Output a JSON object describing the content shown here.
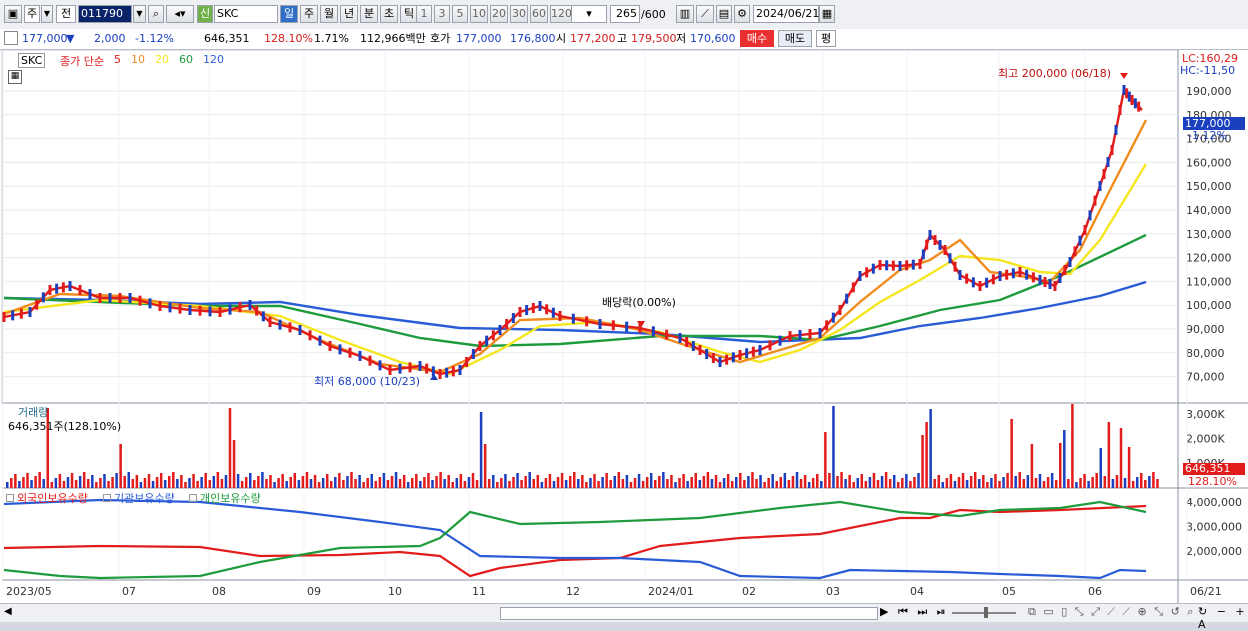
{
  "toolbar": {
    "market_label": "주",
    "view_label": "전",
    "code": "011790",
    "sin_label": "신",
    "name": "SKC",
    "period_tabs": [
      "일",
      "주",
      "월",
      "년",
      "분",
      "초",
      "틱"
    ],
    "active_period": "일",
    "interval_buttons": [
      "1",
      "3",
      "5",
      "10",
      "20",
      "30",
      "60",
      "120"
    ],
    "count": "265",
    "count_total": "/600",
    "date": "2024/06/21"
  },
  "quote": {
    "price": "177,000",
    "change": "2,000",
    "change_rate": "-1.12%",
    "volume": "646,351",
    "volume_ratio": "128.10%",
    "turnover_pct": "1.71%",
    "amount": "112,966백만",
    "ask_label": "호가",
    "ask": "177,000",
    "bid": "176,800",
    "open_label": "시",
    "open": "177,200",
    "high_label": "고",
    "high": "179,500",
    "low_label": "저",
    "low": "170,600",
    "buy_label": "매수",
    "sell_label": "매도",
    "eval_label": "평"
  },
  "price_panel": {
    "stock_label": "SKC",
    "ma_title": "종가 단순",
    "ma_periods": [
      {
        "label": "5",
        "color": "#e21b1b"
      },
      {
        "label": "10",
        "color": "#f08c1e"
      },
      {
        "label": "20",
        "color": "#f5e61e"
      },
      {
        "label": "60",
        "color": "#1e9b3c"
      },
      {
        "label": "120",
        "color": "#2a5bd7"
      }
    ],
    "y_ticks": [
      "190,000",
      "180,000",
      "170,000",
      "160,000",
      "150,000",
      "140,000",
      "130,000",
      "120,000",
      "110,000",
      "100,000",
      "90,000",
      "80,000",
      "70,000"
    ],
    "lc": "LC:160,29",
    "hc": "HC:-11,50",
    "current_price": "177,000",
    "current_change": "-1.12%",
    "high_annotation": "최고 200,000 (06/18)",
    "low_annotation": "최저 68,000 (10/23)",
    "dividend_annotation": "배당락(0.00%)"
  },
  "volume_panel": {
    "title": "거래량",
    "subtitle": "646,351주(128.10%)",
    "y_ticks": [
      "3,000K",
      "2,000K",
      "1,000K"
    ],
    "current": "646,351",
    "ratio": "128.10%"
  },
  "holdings_panel": {
    "legend": [
      {
        "label": "외국인보유수량",
        "color": "#e21b1b"
      },
      {
        "label": "기관보유수량",
        "color": "#2a5bd7"
      },
      {
        "label": "개인보유수량",
        "color": "#1e9b3c"
      }
    ],
    "y_ticks": [
      "4,000,000",
      "3,000,000",
      "2,000,000"
    ]
  },
  "x_axis": [
    "2023/05",
    "07",
    "08",
    "09",
    "10",
    "11",
    "12",
    "2024/01",
    "02",
    "03",
    "04",
    "05",
    "06",
    "06/21"
  ]
}
